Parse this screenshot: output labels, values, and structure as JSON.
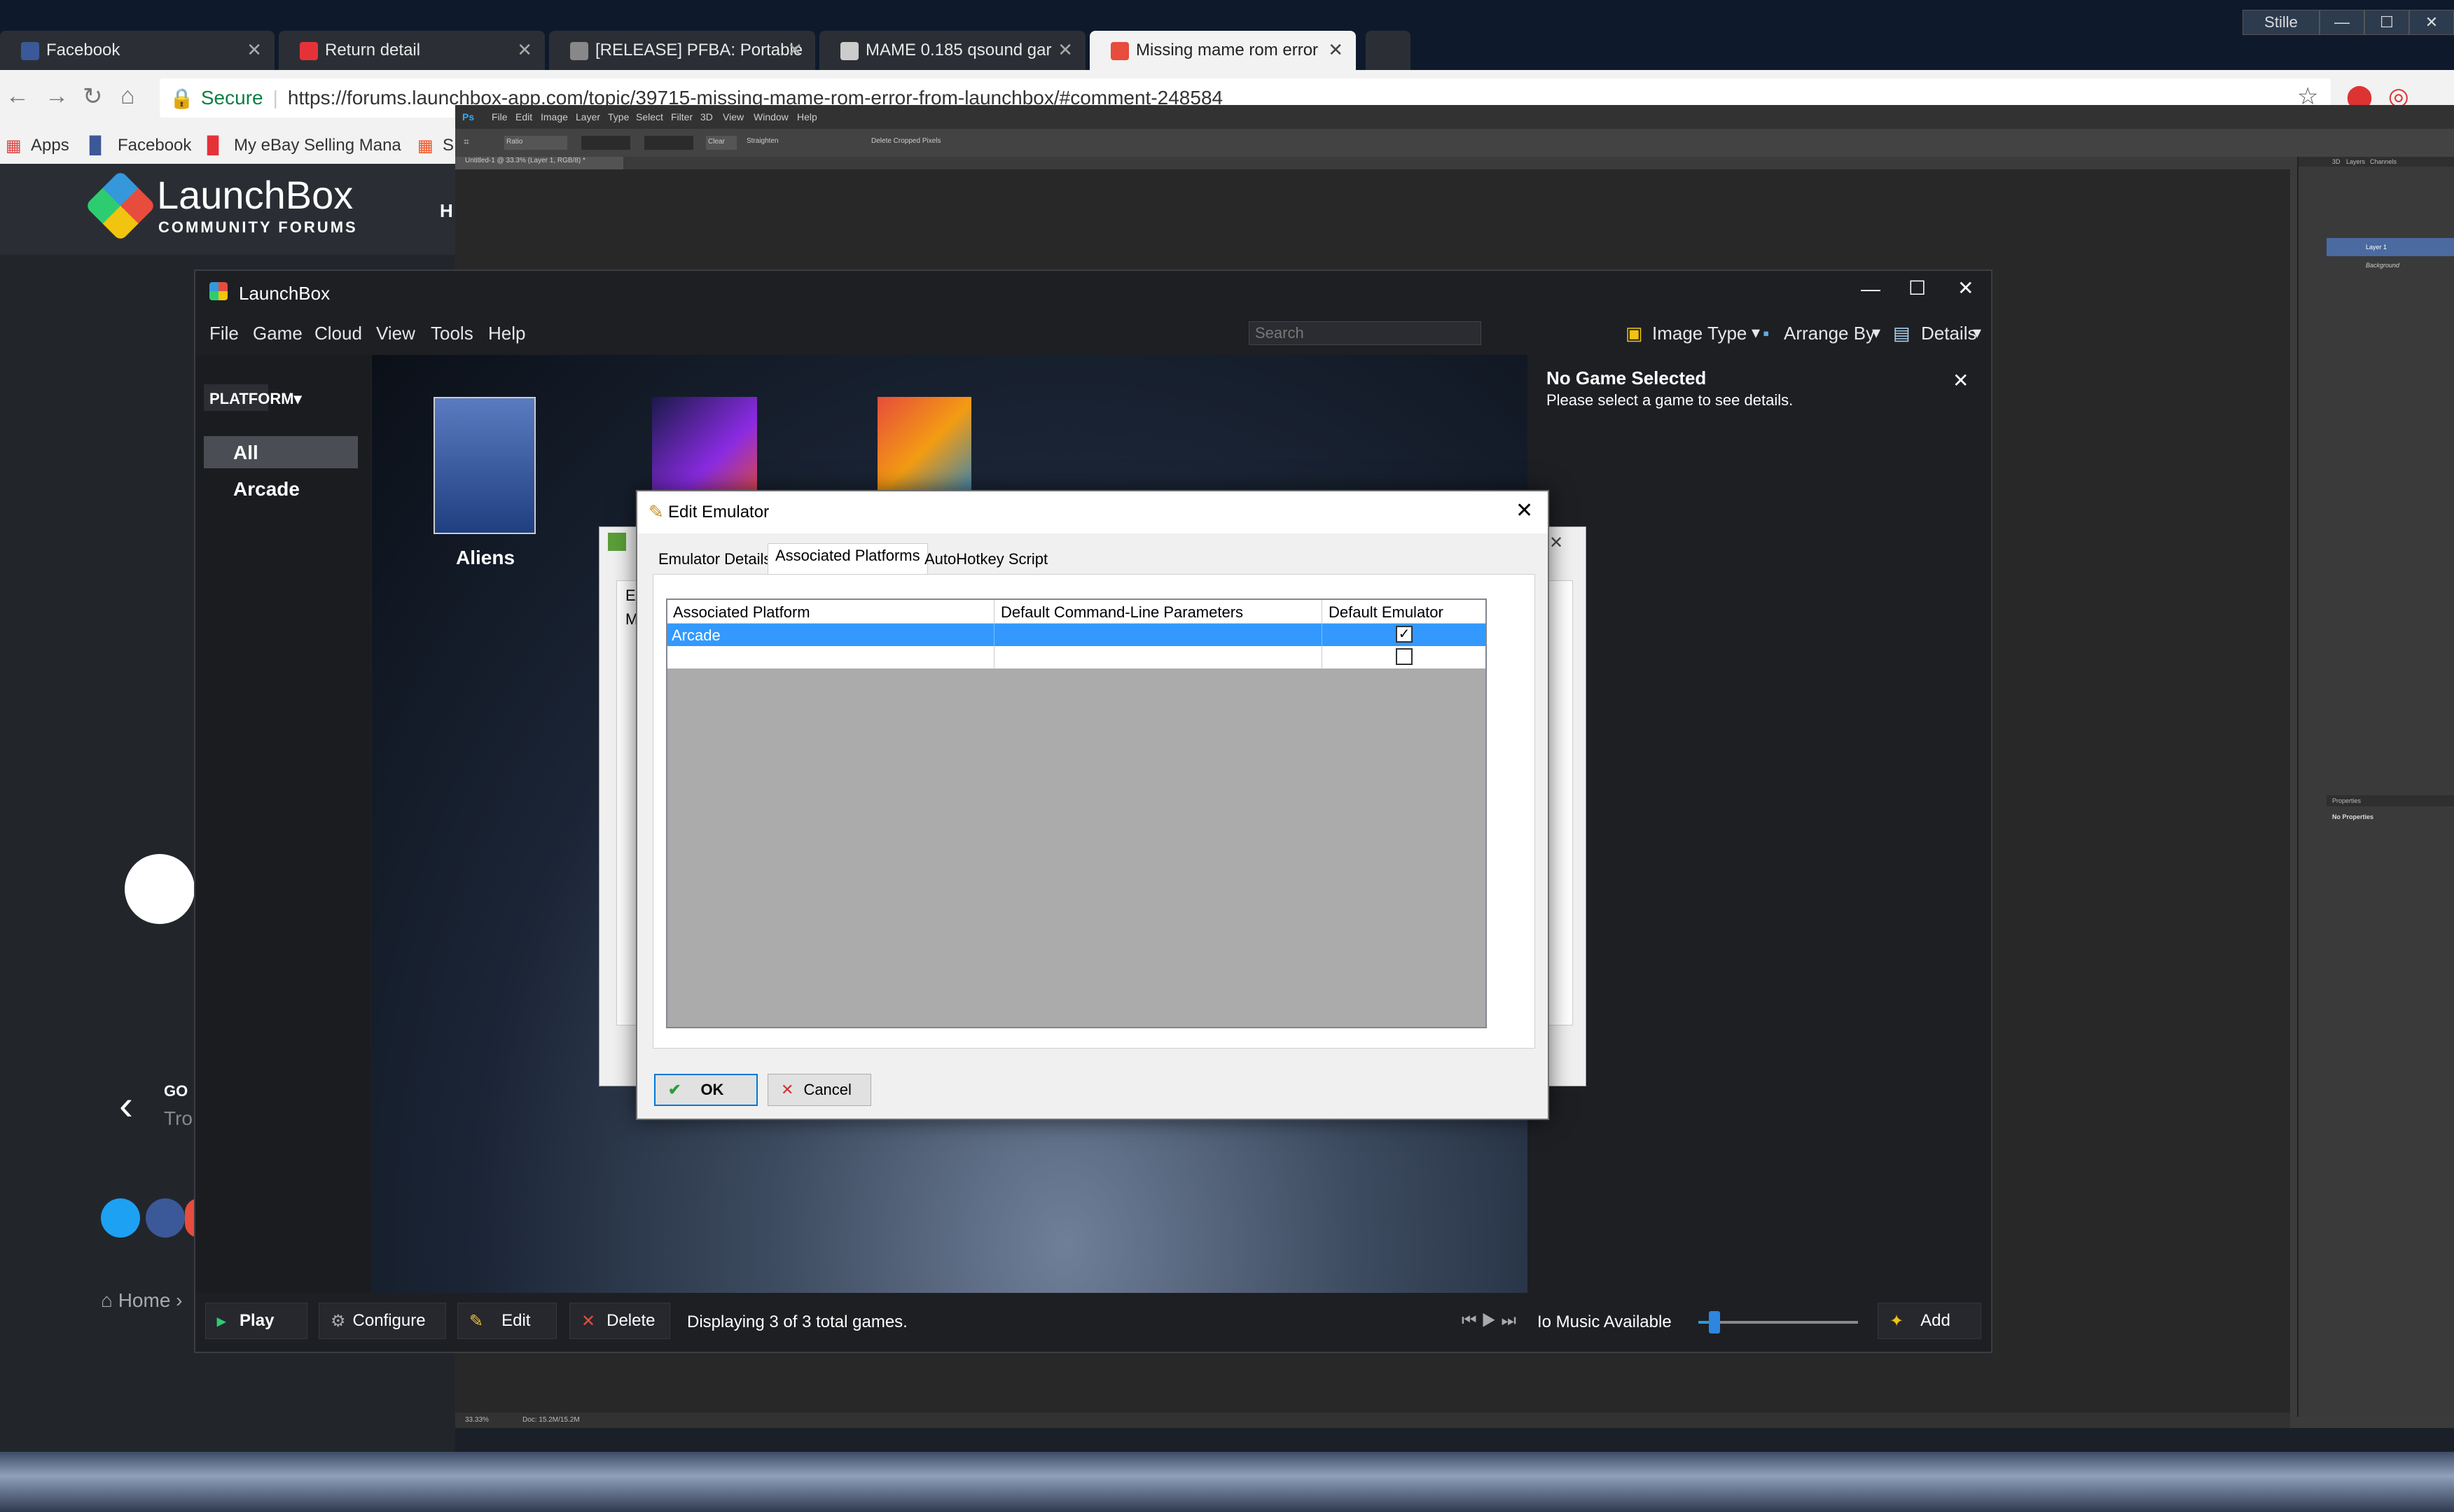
{
  "browser": {
    "tabs": [
      {
        "label": "Facebook",
        "favicon": "facebook-icon",
        "color": "#3b5998"
      },
      {
        "label": "Return detail",
        "favicon": "ebay-icon",
        "color": "#e53238"
      },
      {
        "label": "[RELEASE] PFBA: Portable",
        "favicon": "forum-icon",
        "color": "#888888"
      },
      {
        "label": "MAME 0.185 qsound gar",
        "favicon": "mame-icon",
        "color": "#cccccc"
      },
      {
        "label": "Missing mame rom error",
        "favicon": "launchbox-icon",
        "color": "#e74c3c"
      }
    ],
    "user_label": "Stille",
    "secure_label": "Secure",
    "url": "https://forums.launchbox-app.com/topic/39715-missing-mame-rom-error-from-launchbox/#comment-248584",
    "bookmarks": [
      "Apps",
      "Facebook",
      "My eBay Selling Mana",
      "S"
    ]
  },
  "photoshop": {
    "menu": [
      "Ps",
      "File",
      "Edit",
      "Image",
      "Layer",
      "Type",
      "Select",
      "Filter",
      "3D",
      "View",
      "Window",
      "Help"
    ],
    "doc_tab": "Untitled-1 @ 33.3% (Layer 1, RGB/8) *",
    "status_zoom": "33.33%",
    "status_doc": "Doc: 15.2M/15.2M",
    "options": [
      "Ratio",
      "Clear",
      "Straighten",
      "Delete Cropped Pixels"
    ],
    "panel_tabs": [
      "3D",
      "Layers",
      "Channels"
    ],
    "layers": [
      "Layer 1",
      "Background"
    ],
    "properties_title": "Properties",
    "properties_empty": "No Properties"
  },
  "forum": {
    "logo_title": "LaunchBox",
    "logo_subtitle": "COMMUNITY FORUMS",
    "nav_partial": "H",
    "go_label": "GO",
    "go_sub": "Tro",
    "home_label": "Home"
  },
  "launchbox": {
    "title": "LaunchBox",
    "menu": [
      "File",
      "Game",
      "Cloud",
      "View",
      "Tools",
      "Help"
    ],
    "search_placeholder": "Search",
    "toolbar": {
      "image_type": "Image Type",
      "arrange_by": "Arrange By",
      "details": "Details"
    },
    "platform_label": "PLATFORM",
    "sidebar_items": [
      "All",
      "Arcade"
    ],
    "games": [
      {
        "title": "Aliens"
      },
      {
        "title": ""
      },
      {
        "title": ""
      }
    ],
    "details_title": "No Game Selected",
    "details_text": "Please select a game to see details.",
    "bottom": {
      "play": "Play",
      "configure": "Configure",
      "edit": "Edit",
      "delete": "Delete",
      "status": "Displaying 3 of 3 total games.",
      "music": "Io Music Available",
      "volume": 0.1,
      "add": "Add"
    }
  },
  "emulator_back": {
    "partial_1": "Er",
    "partial_2": "M/"
  },
  "dialog": {
    "title": "Edit Emulator",
    "tabs": [
      "Emulator Details",
      "Associated Platforms",
      "AutoHotkey Script"
    ],
    "selected_tab": "Associated Platforms",
    "columns": [
      "Associated Platform",
      "Default Command-Line Parameters",
      "Default Emulator"
    ],
    "rows": [
      {
        "platform": "Arcade",
        "params": "",
        "default": true
      },
      {
        "platform": "",
        "params": "",
        "default": false
      }
    ],
    "ok": "OK",
    "cancel": "Cancel",
    "selection_color": "#3399ff"
  }
}
